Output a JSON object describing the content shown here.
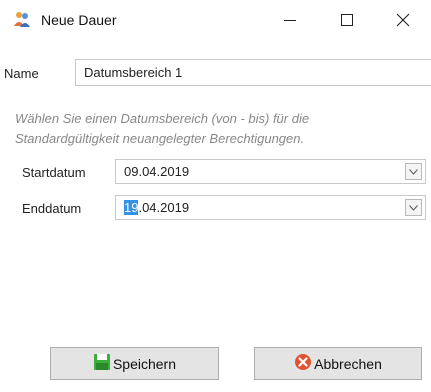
{
  "window": {
    "title": "Neue Dauer",
    "minimize_glyph": "—",
    "maximize_glyph": "☐",
    "close_glyph": "✕"
  },
  "form": {
    "name_label": "Name",
    "name_value": "Datumsbereich 1",
    "hint_line1": "Wählen Sie einen Datumsbereich (von - bis) für die",
    "hint_line2": "Standardgültigkeit neuangelegter Berechtigungen.",
    "start_label": "Startdatum",
    "start_value": "09.04.2019",
    "end_label": "Enddatum",
    "end_value_selected": "19",
    "end_value_rest": ".04.2019"
  },
  "buttons": {
    "save_label": "Speichern",
    "cancel_label": "Abbrechen"
  },
  "icons": {
    "app": "users-icon",
    "save": "save-disk-icon",
    "cancel": "cancel-circle-icon",
    "dropdown": "chevron-down-icon"
  },
  "colors": {
    "selection": "#3391e6",
    "save_icon": "#3cae3c",
    "cancel_icon": "#e0532f",
    "hint_text": "#888888"
  }
}
